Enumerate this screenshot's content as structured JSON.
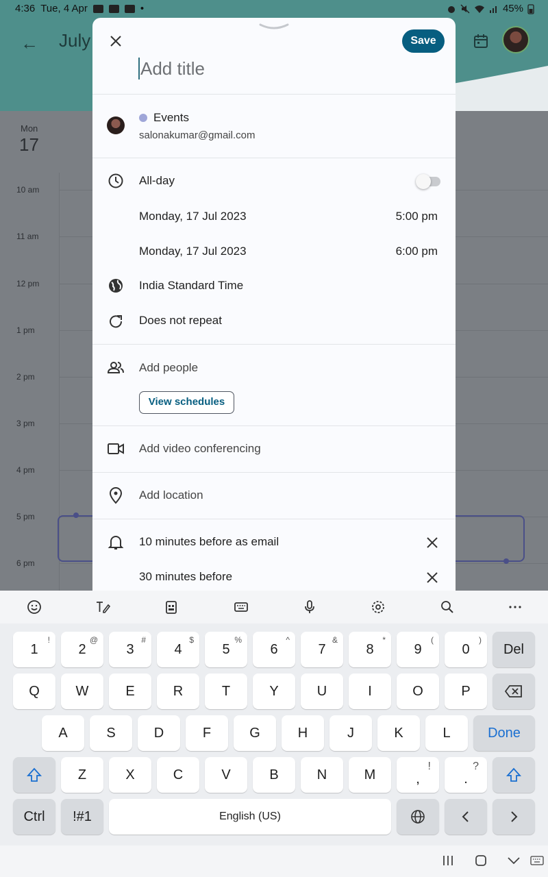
{
  "status_bar": {
    "time": "4:36",
    "date": "Tue, 4 Apr",
    "battery": "45%"
  },
  "background": {
    "month": "July",
    "day_name": "Mon",
    "day_number": "17",
    "hours": [
      "10 am",
      "11 am",
      "12 pm",
      "1 pm",
      "2 pm",
      "3 pm",
      "4 pm",
      "5 pm",
      "6 pm"
    ]
  },
  "sheet": {
    "save_label": "Save",
    "title_placeholder": "Add title",
    "calendar_name": "Events",
    "calendar_color": "#9fa6d8",
    "account_email": "salonakumar@gmail.com",
    "all_day_label": "All-day",
    "all_day_on": false,
    "start_date": "Monday, 17 Jul 2023",
    "start_time": "5:00 pm",
    "end_date": "Monday, 17 Jul 2023",
    "end_time": "6:00 pm",
    "timezone": "India Standard Time",
    "repeat": "Does not repeat",
    "add_people": "Add people",
    "view_schedules": "View schedules",
    "video": "Add video conferencing",
    "location": "Add location",
    "notification_1": "10 minutes before as email",
    "notification_2": "30 minutes before"
  },
  "keyboard": {
    "row1": [
      {
        "main": "1",
        "sup": "!"
      },
      {
        "main": "2",
        "sup": "@"
      },
      {
        "main": "3",
        "sup": "#"
      },
      {
        "main": "4",
        "sup": "$"
      },
      {
        "main": "5",
        "sup": "%"
      },
      {
        "main": "6",
        "sup": "^"
      },
      {
        "main": "7",
        "sup": "&"
      },
      {
        "main": "8",
        "sup": "*"
      },
      {
        "main": "9",
        "sup": "("
      },
      {
        "main": "0",
        "sup": ")"
      }
    ],
    "del": "Del",
    "row2": [
      "Q",
      "W",
      "E",
      "R",
      "T",
      "Y",
      "U",
      "I",
      "O",
      "P"
    ],
    "row3": [
      "A",
      "S",
      "D",
      "F",
      "G",
      "H",
      "J",
      "K",
      "L"
    ],
    "done": "Done",
    "row4": [
      "Z",
      "X",
      "C",
      "V",
      "B",
      "N",
      "M"
    ],
    "comma": {
      "main": ",",
      "sup": "!"
    },
    "period": {
      "main": ".",
      "sup": "?"
    },
    "ctrl": "Ctrl",
    "symbols": "!#1",
    "space": "English (US)"
  },
  "icons": {
    "accent": "#075e80",
    "header_teal": "#4e8f8b"
  }
}
